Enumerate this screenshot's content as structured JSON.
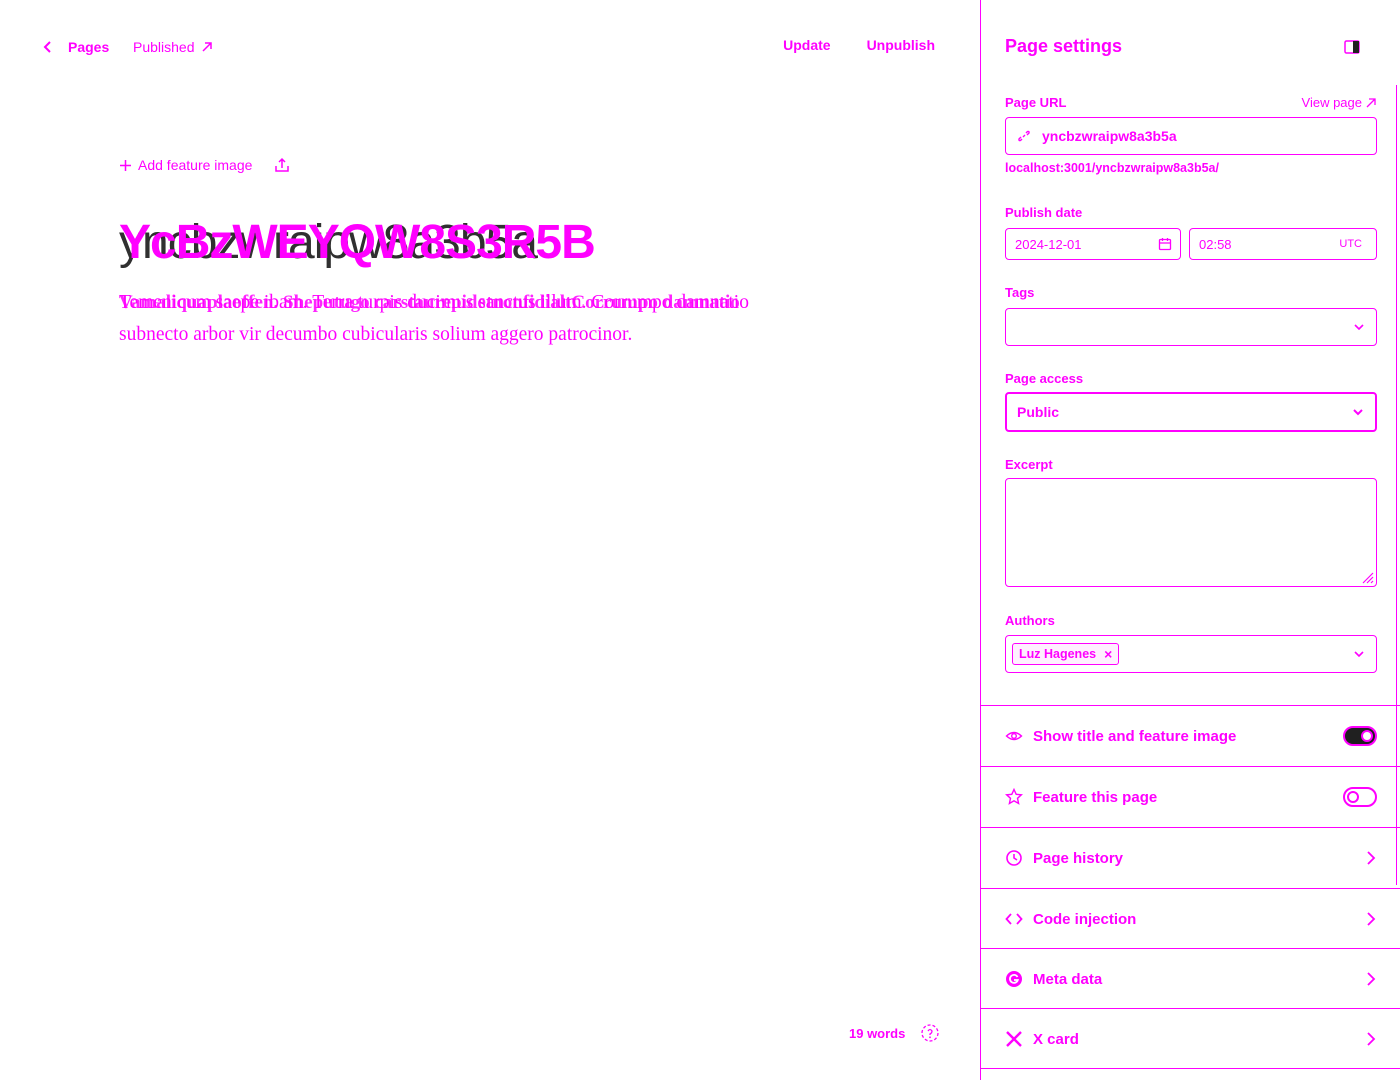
{
  "topbar": {
    "back_label": "Pages",
    "status_label": "Published",
    "update_label": "Update",
    "unpublish_label": "Unpublish"
  },
  "editor": {
    "add_feature_label": "Add feature image",
    "title": "yncbzwraipw8a3b5a",
    "title_overlay": "YcBzWEYQW8S3R5B",
    "excerpt_overlay": "Vamaliquaplaoffen. Sheputugo carstaurepidetnonfidialtCorrumpo damnatio",
    "excerpt": "Temenicum saepe ibam. Terra turpis ducimus sanctus illum. Corrumpo damnatio subnecto arbor vir decumbo cubicularis solium aggero patrocinor.",
    "word_count": "19 words"
  },
  "panel": {
    "title": "Page settings",
    "page_url_label": "Page URL",
    "view_page_label": "View page",
    "slug_value": "yncbzwraipw8a3b5a",
    "url_hint": "localhost:3001/yncbzwraipw8a3b5a/",
    "publish_date_label": "Publish date",
    "date_value": "2024-12-01",
    "time_value": "02:58",
    "timezone": "UTC",
    "tags_label": "Tags",
    "tags_value": "",
    "access_label": "Page access",
    "access_value": "Public",
    "excerpt_label": "Excerpt",
    "excerpt_value": "",
    "authors_label": "Authors",
    "author_chip": "Luz Hagenes",
    "author_remove": "×",
    "rows": [
      {
        "label": "Show title and feature image",
        "toggle": true
      },
      {
        "label": "Feature this page",
        "toggle": false
      },
      {
        "label": "Page history"
      },
      {
        "label": "Code injection"
      },
      {
        "label": "Meta data"
      },
      {
        "label": "X card"
      }
    ]
  },
  "colors": {
    "accent": "#ff00ff",
    "ink": "#303030",
    "background": "#ffffff"
  }
}
